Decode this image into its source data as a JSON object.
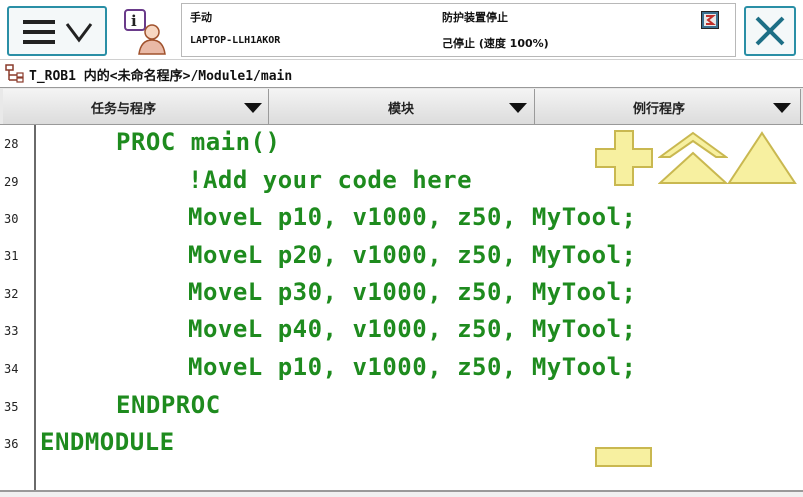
{
  "header": {
    "operating_mode": "手动",
    "controller_name": "LAPTOP-LLH1AKOR",
    "safety_status": "防护装置停止",
    "speed_status": "己停止 (速度 100%)"
  },
  "path": {
    "text": "T_ROB1 内的<未命名程序>/Module1/main"
  },
  "tabs": [
    {
      "label": "任务与程序"
    },
    {
      "label": "模块"
    },
    {
      "label": "例行程序"
    }
  ],
  "code": {
    "lines": [
      {
        "num": "28",
        "text": "PROC main()"
      },
      {
        "num": "29",
        "text": "!Add your code here"
      },
      {
        "num": "30",
        "text": "MoveL p10, v1000, z50, MyTool;"
      },
      {
        "num": "31",
        "text": "MoveL p20, v1000, z50, MyTool;"
      },
      {
        "num": "32",
        "text": "MoveL p30, v1000, z50, MyTool;"
      },
      {
        "num": "33",
        "text": "MoveL p40, v1000, z50, MyTool;"
      },
      {
        "num": "34",
        "text": "MoveL p10, v1000, z50, MyTool;"
      },
      {
        "num": "35",
        "text": "ENDPROC"
      },
      {
        "num": "36",
        "text": "ENDMODULE"
      }
    ]
  },
  "colors": {
    "code_green": "#1e8b1e",
    "control_yellow": "#f7f0a0",
    "accent_teal": "#2a8fa6"
  },
  "icons": {
    "menu": "hamburger-chevron-icon",
    "status": "info-person-icon",
    "panel": "robot-status-icon",
    "close": "close-icon",
    "path": "program-tree-icon",
    "zoom_in": "plus-icon",
    "zoom_out": "minus-icon",
    "page_up": "double-chevron-up-icon",
    "top": "triangle-up-icon"
  }
}
